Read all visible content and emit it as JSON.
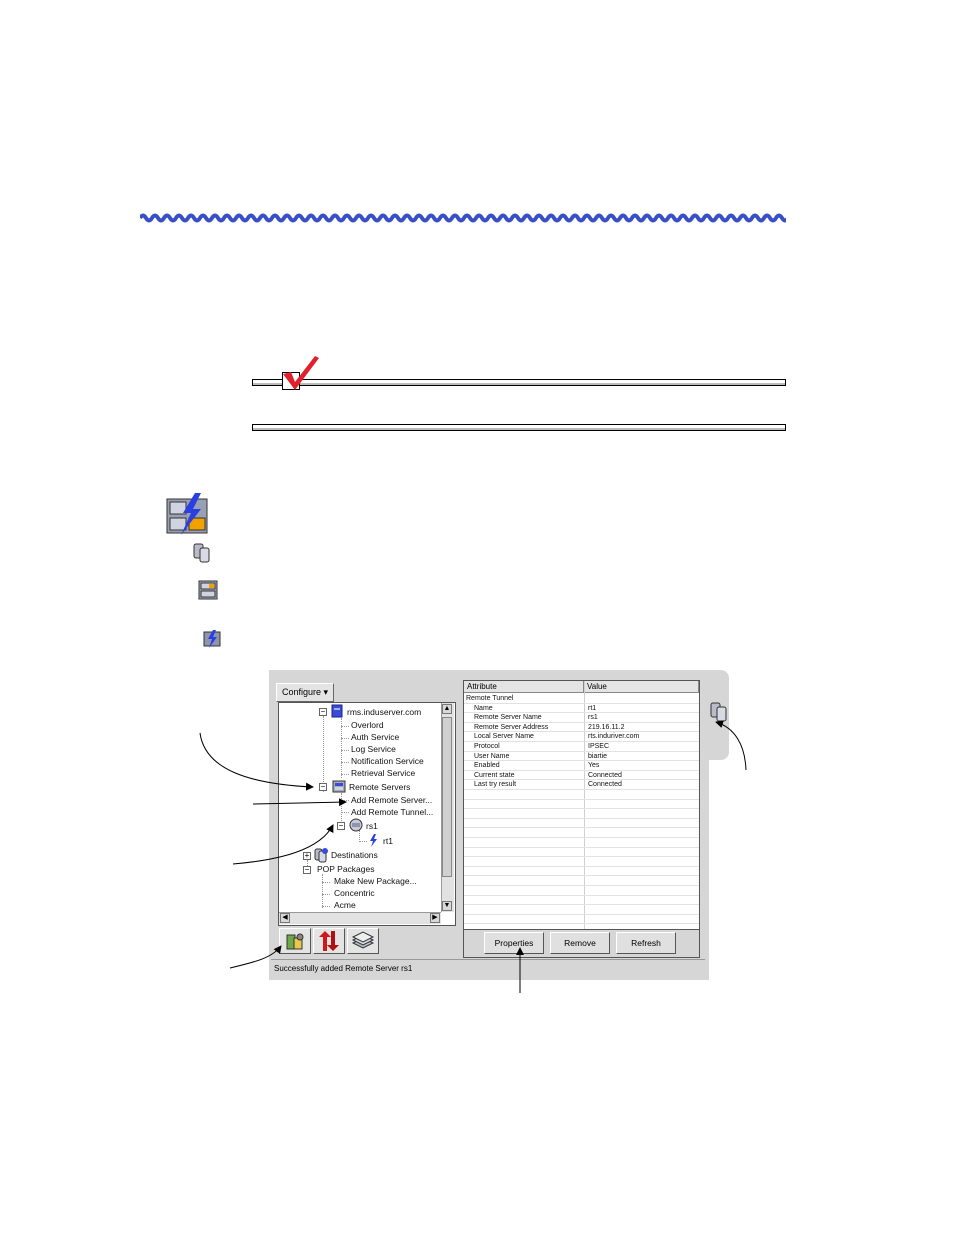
{
  "window": {
    "configure_label": "Configure ▾",
    "status_text": "Successfully added Remote Server rs1"
  },
  "tree": {
    "server": "rms.induserver.com",
    "services": [
      "Overlord",
      "Auth Service",
      "Log Service",
      "Notification Service",
      "Retrieval Service"
    ],
    "remote_servers": "Remote Servers",
    "add_remote_server": "Add Remote Server...",
    "add_remote_tunnel": "Add Remote Tunnel...",
    "rs1": "rs1",
    "rt1": "rt1",
    "destinations": "Destinations",
    "pop_packages": "POP Packages",
    "pop_items": [
      "Make New Package...",
      "Concentric",
      "Acme"
    ]
  },
  "grid": {
    "col_attribute": "Attribute",
    "col_value": "Value",
    "section": "Remote Tunnel",
    "rows": [
      {
        "attr": "Name",
        "value": "rt1"
      },
      {
        "attr": "Remote Server Name",
        "value": "rs1"
      },
      {
        "attr": "Remote Server Address",
        "value": "219.16.11.2"
      },
      {
        "attr": "Local Server Name",
        "value": "rts.induriver.com"
      },
      {
        "attr": "Protocol",
        "value": "IPSEC"
      },
      {
        "attr": "User Name",
        "value": "biartie"
      },
      {
        "attr": "Enabled",
        "value": "Yes"
      },
      {
        "attr": "Current state",
        "value": "Connected"
      },
      {
        "attr": "Last try result",
        "value": "Connected"
      }
    ]
  },
  "buttons": {
    "properties": "Properties",
    "remove": "Remove",
    "refresh": "Refresh"
  },
  "colors": {
    "wave": "#3a4fc6",
    "check": "#e0202a",
    "window_bg": "#d6d6d6"
  }
}
